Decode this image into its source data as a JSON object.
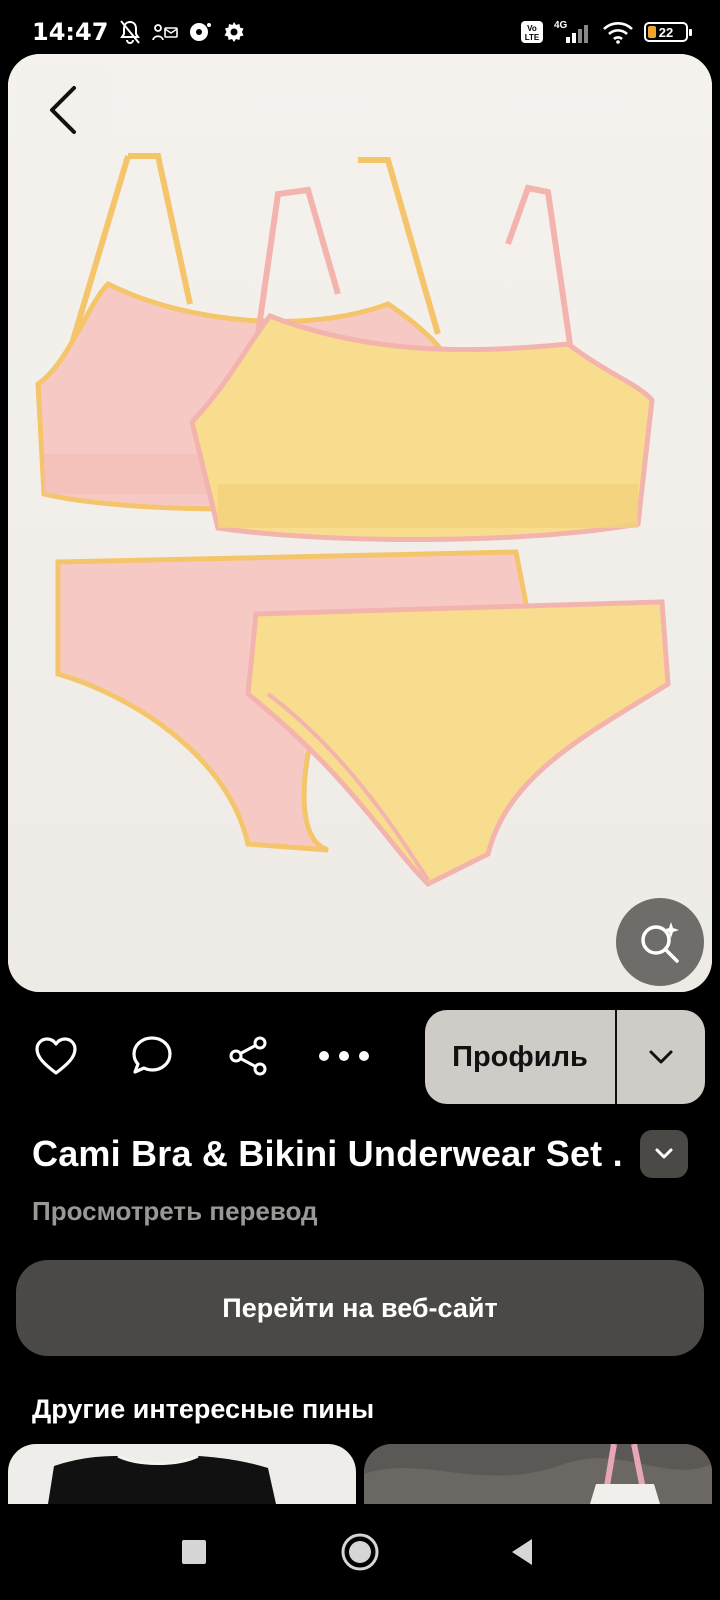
{
  "status_bar": {
    "time": "14:47",
    "network": "4G",
    "volte": "Vo LTE",
    "battery": "22"
  },
  "pin": {
    "title": "Cami Bra & Bikini Underwear Set ...",
    "translate_label": "Просмотреть перевод",
    "website_label": "Перейти на веб-сайт",
    "profile_label": "Профиль"
  },
  "more_section": {
    "heading": "Другие интересные пины"
  },
  "colors": {
    "background": "#000000",
    "pin_bg": "#f3f0ec",
    "button_dark": "#4a4945",
    "button_light": "#cfccc7",
    "muted_text": "#9a9894"
  },
  "icons": [
    "back-arrow-icon",
    "visual-search-icon",
    "heart-icon",
    "comment-icon",
    "share-icon",
    "more-icon",
    "chevron-down-icon"
  ]
}
